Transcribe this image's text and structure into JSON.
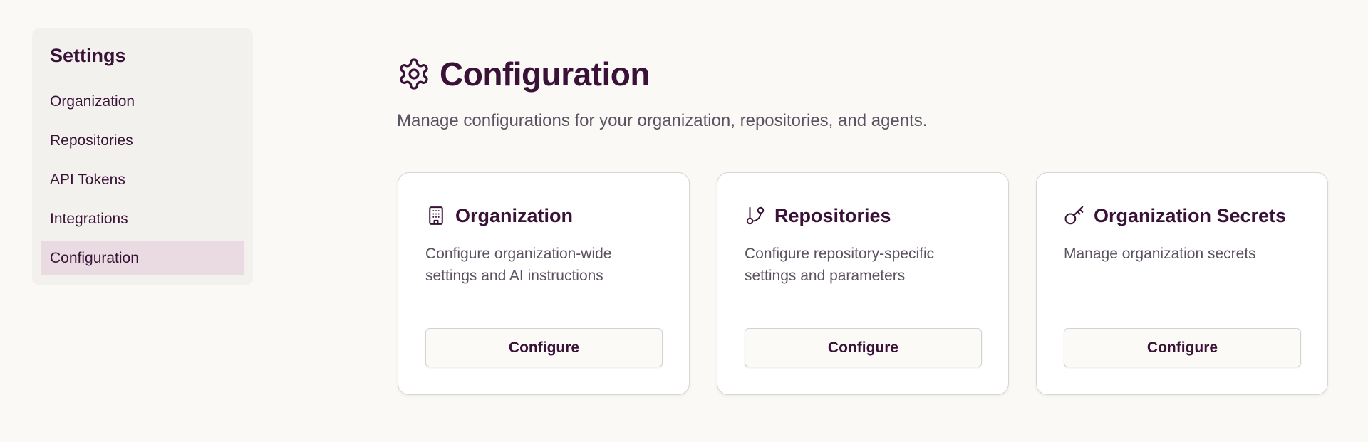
{
  "sidebar": {
    "title": "Settings",
    "items": [
      {
        "label": "Organization",
        "active": false
      },
      {
        "label": "Repositories",
        "active": false
      },
      {
        "label": "API Tokens",
        "active": false
      },
      {
        "label": "Integrations",
        "active": false
      },
      {
        "label": "Configuration",
        "active": true
      }
    ]
  },
  "header": {
    "icon": "gear-icon",
    "title": "Configuration",
    "subtitle": "Manage configurations for your organization, repositories, and agents."
  },
  "cards": [
    {
      "icon": "building-icon",
      "title": "Organization",
      "description": "Configure organization-wide settings and AI instructions",
      "button_label": "Configure"
    },
    {
      "icon": "git-branch-icon",
      "title": "Repositories",
      "description": "Configure repository-specific settings and parameters",
      "button_label": "Configure"
    },
    {
      "icon": "key-icon",
      "title": "Organization Secrets",
      "description": "Manage organization secrets",
      "button_label": "Configure"
    }
  ],
  "colors": {
    "background": "#faf9f6",
    "sidebar_background": "#f3f1ee",
    "active_item_background": "#e9dbe1",
    "text_primary": "#3a1238",
    "text_secondary": "#5b5160",
    "card_border": "#d9d4d6"
  }
}
